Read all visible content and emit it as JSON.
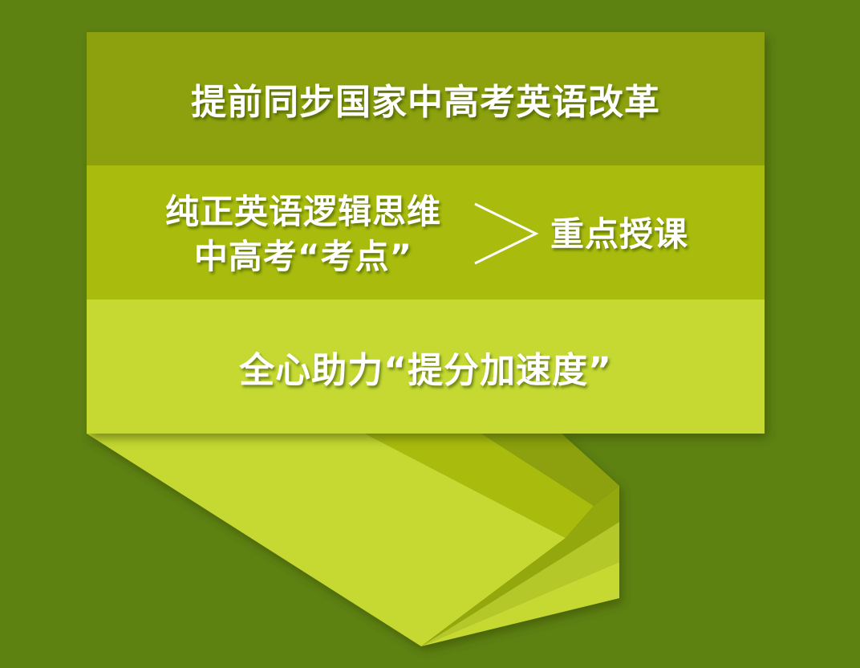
{
  "colors": {
    "background": "#5e8212",
    "band_top": "#8ca10a",
    "band_middle": "#a9bc0c",
    "band_bottom": "#c5d932",
    "text": "#ffffff"
  },
  "banner": {
    "line1": "提前同步国家中高考英语改革",
    "line2_left_a": "纯正英语逻辑思维",
    "line2_left_b": "中高考“考点”",
    "line2_right": "重点授课",
    "line3": "全心助力“提分加速度”"
  }
}
